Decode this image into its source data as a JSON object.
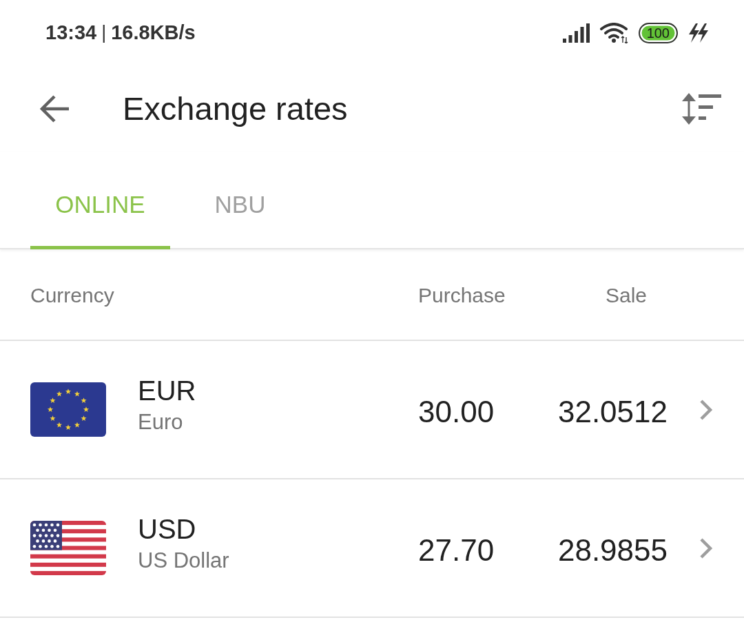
{
  "status_bar": {
    "time": "13:34",
    "separator": "|",
    "speed": "16.8KB/s",
    "battery": "100"
  },
  "app_bar": {
    "title": "Exchange rates"
  },
  "tabs": [
    {
      "label": "ONLINE",
      "selected": true
    },
    {
      "label": "NBU",
      "selected": false
    }
  ],
  "table": {
    "columns": [
      "Currency",
      "Purchase",
      "Sale"
    ],
    "rows": [
      {
        "kind": "eu",
        "code": "EUR",
        "name": "Euro",
        "purchase": "30.00",
        "sale": "32.0512"
      },
      {
        "kind": "us",
        "code": "USD",
        "name": "US Dollar",
        "purchase": "27.70",
        "sale": "28.9855"
      }
    ]
  }
}
